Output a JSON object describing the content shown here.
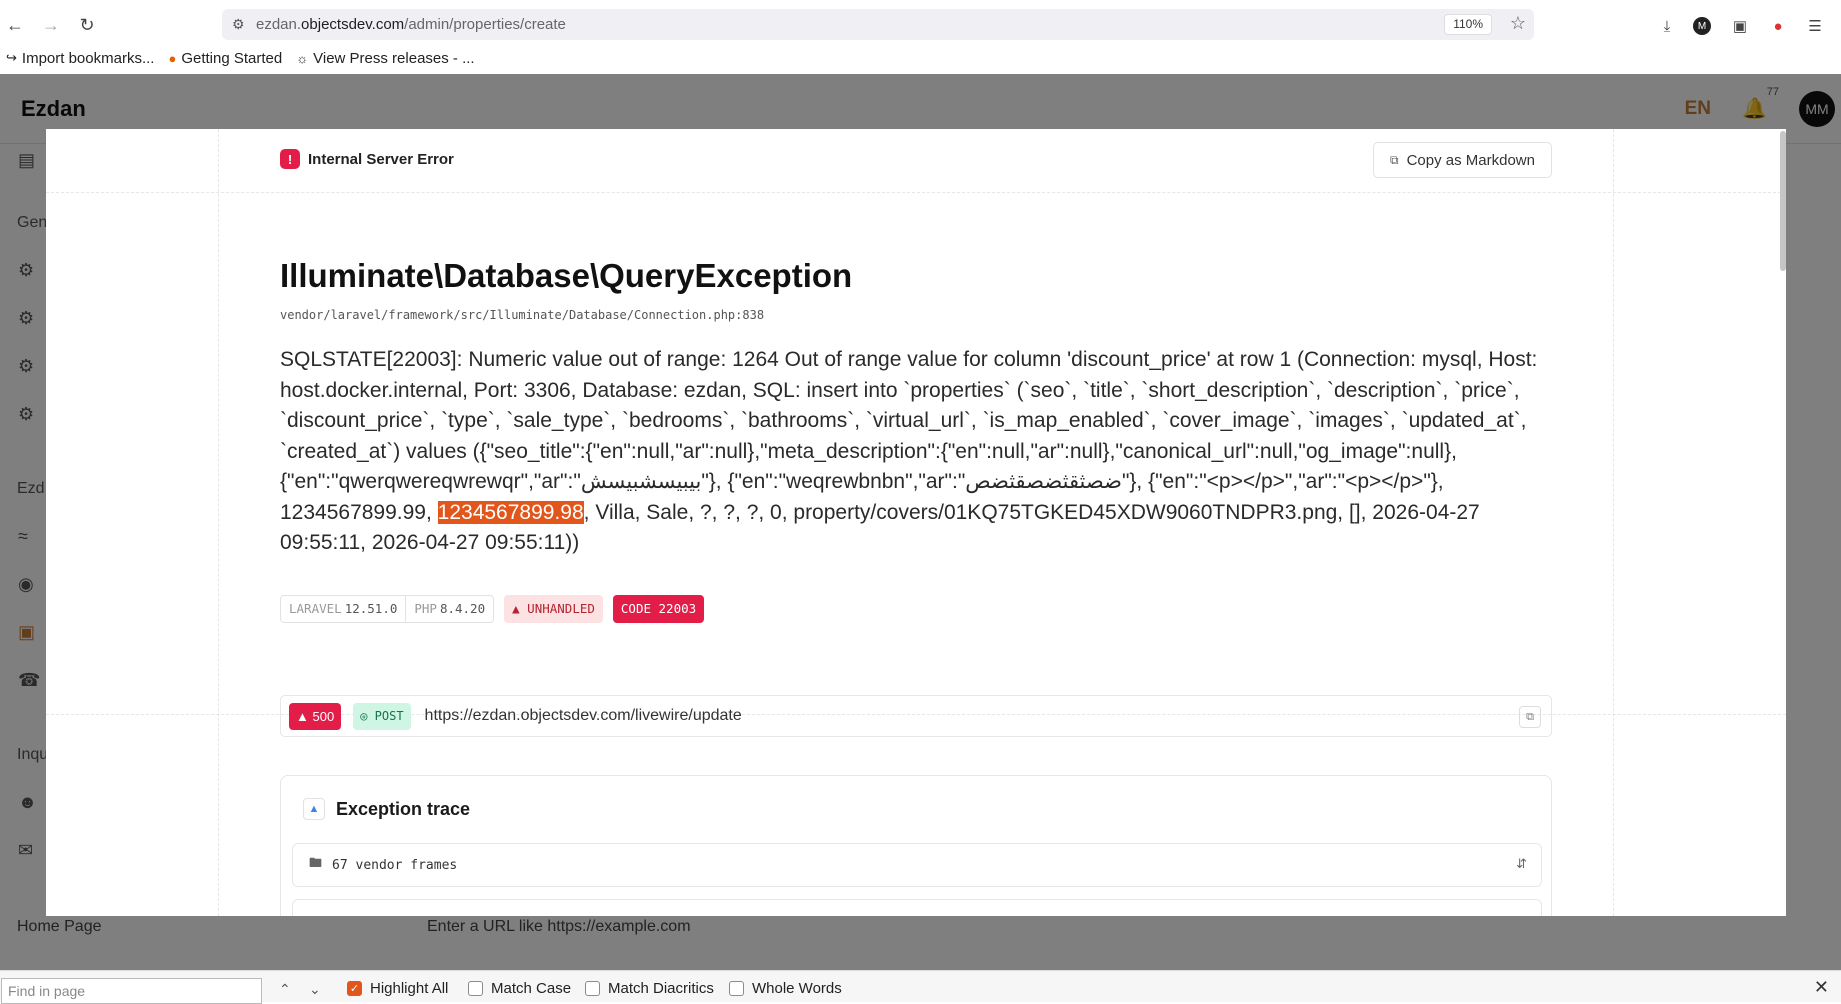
{
  "browser": {
    "url_prefix": "ezdan.",
    "url_host": "objectsdev.com",
    "url_path": "/admin/properties/create",
    "zoom": "110%",
    "bookmarks": [
      {
        "label": "Import bookmarks...",
        "icon": "import-icon"
      },
      {
        "label": "Getting Started",
        "icon": "firefox-icon"
      },
      {
        "label": "View Press releases - ...",
        "icon": "globe-icon"
      }
    ]
  },
  "app": {
    "brand": "Ezdan",
    "lang": "EN",
    "notif_count": "77",
    "avatar": "MM",
    "side_labels": [
      "Gen",
      "Ezd",
      "Inqu"
    ],
    "below_modal_label": "Home Page",
    "below_modal_placeholder": "Enter a URL like https://example.com"
  },
  "error": {
    "header": "Internal Server Error",
    "copy_button": "Copy as Markdown",
    "exception_class": "Illuminate\\Database\\QueryException",
    "file": "vendor/laravel/framework/src/Illuminate/Database/Connection.php:838",
    "message_before": "SQLSTATE[22003]: Numeric value out of range: 1264 Out of range value for column 'discount_price' at row 1 (Connection: mysql, Host: host.docker.internal, Port: 3306, Database: ezdan, SQL: insert into `properties` (`seo`, `title`, `short_description`, `description`, `price`, `discount_price`, `type`, `sale_type`, `bedrooms`, `bathrooms`, `virtual_url`, `is_map_enabled`, `cover_image`, `images`, `updated_at`, `created_at`) values ({\"seo_title\":{\"en\":null,\"ar\":null},\"meta_description\":{\"en\":null,\"ar\":null},\"canonical_url\":null,\"og_image\":null}, {\"en\":\"qwerqwereqwrewqr\",\"ar\":\"بيبيسشبيسش\"}, {\"en\":\"weqrewbnbn\",\"ar\":\"ضصثقثضصقثضص\"}, {\"en\":\"<p></p>\",\"ar\":\"<p></p>\"}, 1234567899.99, ",
    "message_highlight": "1234567899.98",
    "message_after": ", Villa, Sale, ?, ?, ?, 0, property/covers/01KQ75TGKED45XDW9060TNDPR3.png, [], 2026-04-27 09:55:11, 2026-04-27 09:55:11))",
    "tags": {
      "laravel_label": "LARAVEL",
      "laravel_version": "12.51.0",
      "php_label": "PHP",
      "php_version": "8.4.20",
      "unhandled": "UNHANDLED",
      "code": "CODE 22003"
    },
    "request": {
      "status": "500",
      "method": "POST",
      "url": "https://ezdan.objectsdev.com/livewire/update"
    },
    "trace": {
      "title": "Exception trace",
      "vendor_frames": "67 vendor frames"
    }
  },
  "findbar": {
    "placeholder": "Find in page",
    "options": [
      {
        "label": "Highlight All",
        "checked": true
      },
      {
        "label": "Match Case",
        "checked": false
      },
      {
        "label": "Match Diacritics",
        "checked": false
      },
      {
        "label": "Whole Words",
        "checked": false
      }
    ]
  },
  "colors": {
    "accent": "#e2551b",
    "error_red": "#e11d48",
    "brand_lang": "#c77c3b"
  }
}
